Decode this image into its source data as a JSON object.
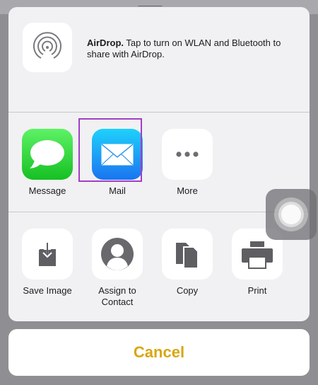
{
  "airdrop": {
    "title": "AirDrop.",
    "message": " Tap to turn on WLAN and Bluetooth to share with AirDrop."
  },
  "share_row": [
    {
      "label": "Message",
      "icon": "message-icon"
    },
    {
      "label": "Mail",
      "icon": "mail-icon"
    },
    {
      "label": "More",
      "icon": "more-dots-icon"
    }
  ],
  "action_row": [
    {
      "label": "Save Image",
      "icon": "save-image-icon"
    },
    {
      "label": "Assign to Contact",
      "icon": "contact-icon"
    },
    {
      "label": "Copy",
      "icon": "copy-icon"
    },
    {
      "label": "Print",
      "icon": "print-icon"
    }
  ],
  "cancel_label": "Cancel",
  "colors": {
    "cancel_text": "#d9a60f",
    "highlight": "#a23ec6",
    "sheet_bg": "#f1f1f3"
  }
}
